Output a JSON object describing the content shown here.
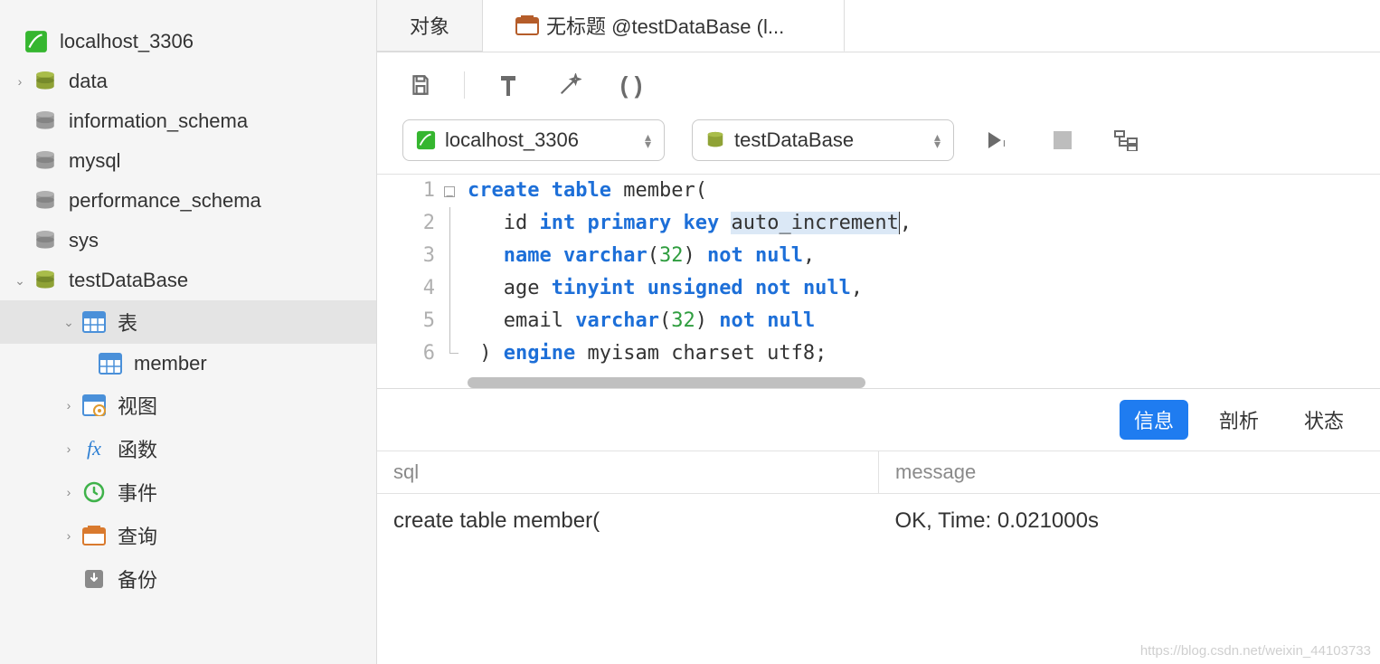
{
  "sidebar": {
    "connection": "localhost_3306",
    "databases": [
      "data",
      "information_schema",
      "mysql",
      "performance_schema",
      "sys"
    ],
    "current_db": "testDataBase",
    "folders": {
      "tables": "表",
      "views": "视图",
      "functions": "函数",
      "events": "事件",
      "queries": "查询",
      "backups": "备份"
    },
    "tables": [
      "member"
    ]
  },
  "tabs": {
    "objects": "对象",
    "query": "无标题 @testDataBase (l..."
  },
  "pickers": {
    "connection": "localhost_3306",
    "database": "testDataBase"
  },
  "editor": {
    "lines": [
      {
        "n": "1",
        "tokens": [
          [
            "kw",
            "create"
          ],
          [
            "sp",
            " "
          ],
          [
            "kw",
            "table"
          ],
          [
            "sp",
            " "
          ],
          [
            "id",
            "member"
          ],
          [
            "id",
            "("
          ]
        ]
      },
      {
        "n": "2",
        "tokens": [
          [
            "sp",
            "   "
          ],
          [
            "id",
            "id"
          ],
          [
            "sp",
            " "
          ],
          [
            "kw",
            "int"
          ],
          [
            "sp",
            " "
          ],
          [
            "kw",
            "primary"
          ],
          [
            "sp",
            " "
          ],
          [
            "kw",
            "key"
          ],
          [
            "sp",
            " "
          ],
          [
            "hl",
            "auto_increment"
          ],
          [
            "id",
            ","
          ]
        ]
      },
      {
        "n": "3",
        "tokens": [
          [
            "sp",
            "   "
          ],
          [
            "kw",
            "name"
          ],
          [
            "sp",
            " "
          ],
          [
            "kw",
            "varchar"
          ],
          [
            "id",
            "("
          ],
          [
            "num",
            "32"
          ],
          [
            "id",
            ")"
          ],
          [
            "sp",
            " "
          ],
          [
            "kw",
            "not"
          ],
          [
            "sp",
            " "
          ],
          [
            "kw",
            "null"
          ],
          [
            "id",
            ","
          ]
        ]
      },
      {
        "n": "4",
        "tokens": [
          [
            "sp",
            "   "
          ],
          [
            "id",
            "age"
          ],
          [
            "sp",
            " "
          ],
          [
            "kw",
            "tinyint"
          ],
          [
            "sp",
            " "
          ],
          [
            "kw",
            "unsigned"
          ],
          [
            "sp",
            " "
          ],
          [
            "kw",
            "not"
          ],
          [
            "sp",
            " "
          ],
          [
            "kw",
            "null"
          ],
          [
            "id",
            ","
          ]
        ]
      },
      {
        "n": "5",
        "tokens": [
          [
            "sp",
            "   "
          ],
          [
            "id",
            "email"
          ],
          [
            "sp",
            " "
          ],
          [
            "kw",
            "varchar"
          ],
          [
            "id",
            "("
          ],
          [
            "num",
            "32"
          ],
          [
            "id",
            ")"
          ],
          [
            "sp",
            " "
          ],
          [
            "kw",
            "not"
          ],
          [
            "sp",
            " "
          ],
          [
            "kw",
            "null"
          ]
        ]
      },
      {
        "n": "6",
        "tokens": [
          [
            "sp",
            " "
          ],
          [
            "id",
            ")"
          ],
          [
            "sp",
            " "
          ],
          [
            "kw",
            "engine"
          ],
          [
            "sp",
            " "
          ],
          [
            "id",
            "myisam charset utf8"
          ],
          [
            "id",
            ";"
          ]
        ]
      }
    ]
  },
  "result_tabs": {
    "info": "信息",
    "profile": "剖析",
    "status": "状态"
  },
  "result_headers": {
    "sql": "sql",
    "message": "message"
  },
  "result_row": {
    "sql": "create table member(",
    "message": "OK, Time: 0.021000s"
  },
  "watermark": "https://blog.csdn.net/weixin_44103733"
}
